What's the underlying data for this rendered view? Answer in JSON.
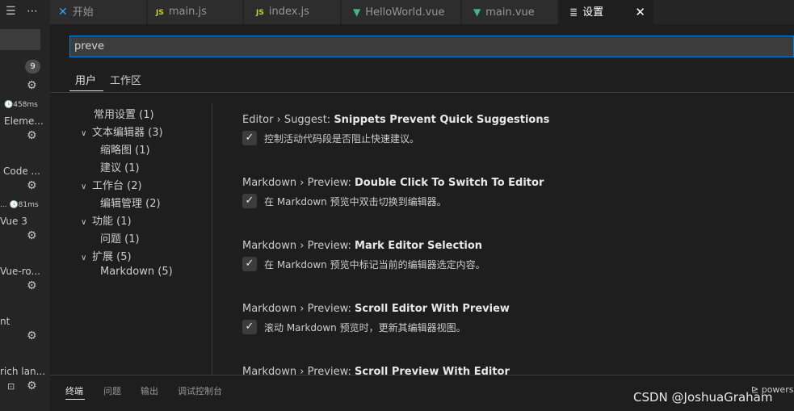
{
  "colors": {
    "accent": "#007fd4",
    "js_icon": "#cbcb41",
    "vue_icon": "#41b883",
    "vscode_blue": "#3ea1e8"
  },
  "extensions": {
    "badge": "9",
    "items": [
      {
        "meta": "458ms",
        "name": "Eleme..."
      },
      {
        "name": "Code ..."
      },
      {
        "meta": "81ms",
        "prefix": "...",
        "name": "Vue 3"
      },
      {
        "name": "Vue-ro..."
      },
      {
        "name": "nt"
      },
      {
        "name": "rich lan..."
      }
    ]
  },
  "tabs": [
    {
      "label": "开始",
      "icon": "vscode-icon"
    },
    {
      "label": "main.js",
      "icon": "js-icon",
      "badge": "JS"
    },
    {
      "label": "index.js",
      "icon": "js-icon",
      "badge": "JS"
    },
    {
      "label": "HelloWorld.vue",
      "icon": "vue-icon"
    },
    {
      "label": "main.vue",
      "icon": "vue-icon"
    },
    {
      "label": "设置",
      "icon": "settings-icon",
      "active": true
    }
  ],
  "settings": {
    "search_value": "preve",
    "scopes": {
      "user": "用户",
      "workspace": "工作区"
    },
    "toc": [
      {
        "label": "常用设置 (1)"
      },
      {
        "label": "文本编辑器 (3)",
        "expandable": true
      },
      {
        "label": "缩略图 (1)"
      },
      {
        "label": "建议 (1)"
      },
      {
        "label": "工作台 (2)",
        "expandable": true
      },
      {
        "label": "编辑管理 (2)"
      },
      {
        "label": "功能 (1)",
        "expandable": true
      },
      {
        "label": "问题 (1)"
      },
      {
        "label": "扩展 (5)",
        "expandable": true
      },
      {
        "label": "Markdown (5)"
      }
    ],
    "items": [
      {
        "category": "Editor › Suggest: ",
        "name": "Snippets Prevent Quick Suggestions",
        "description": "控制活动代码段是否阻止快速建议。",
        "checked": true
      },
      {
        "category": "Markdown › Preview: ",
        "name": "Double Click To Switch To Editor",
        "description": "在 Markdown 预览中双击切换到编辑器。",
        "checked": true
      },
      {
        "category": "Markdown › Preview: ",
        "name": "Mark Editor Selection",
        "description": "在 Markdown 预览中标记当前的编辑器选定内容。",
        "checked": true
      },
      {
        "category": "Markdown › Preview: ",
        "name": "Scroll Editor With Preview",
        "description": "滚动 Markdown 预览时，更新其编辑器视图。",
        "checked": true
      },
      {
        "category": "Markdown › Preview: ",
        "name": "Scroll Preview With Editor"
      }
    ]
  },
  "panel": {
    "tabs": [
      "终端",
      "问题",
      "输出",
      "调试控制台"
    ],
    "terminal_label": "powers"
  },
  "watermark": "CSDN @JoshuaGraham"
}
